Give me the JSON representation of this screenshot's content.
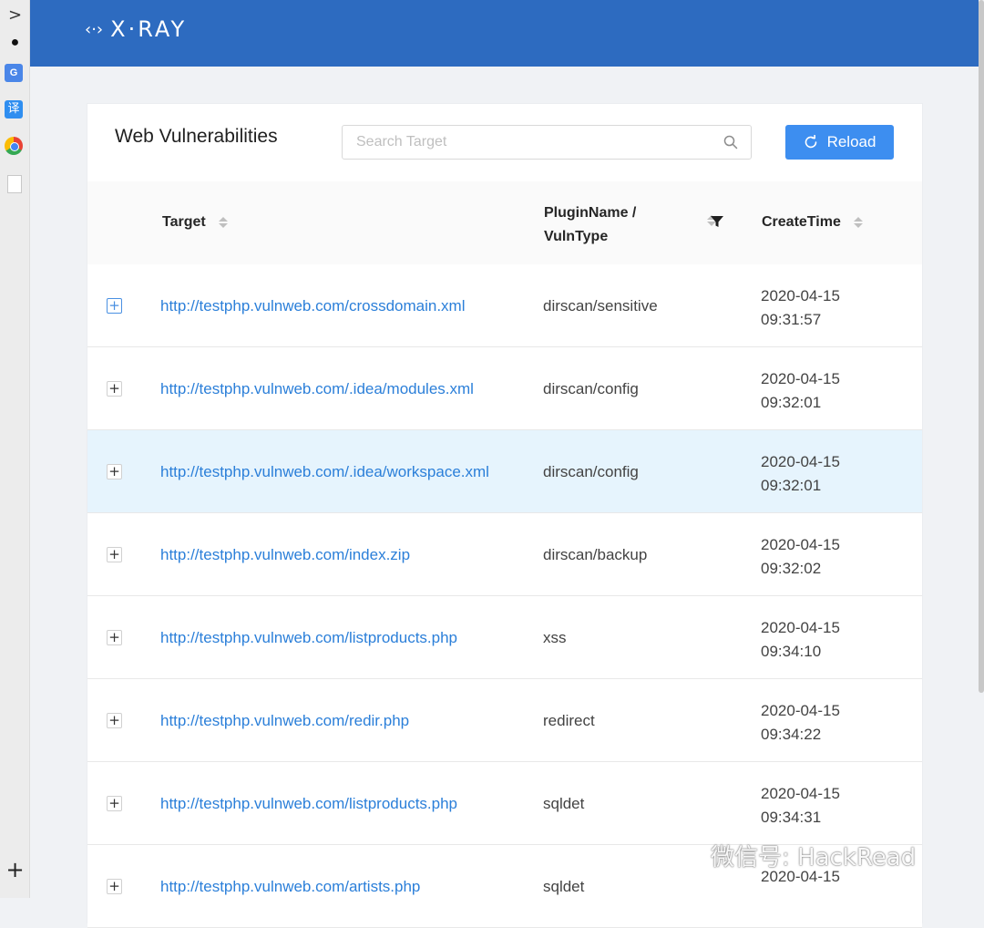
{
  "header": {
    "logo_text": "X·RAY",
    "logo_mark": "‹·›"
  },
  "card": {
    "title": "Web Vulnerabilities",
    "search_placeholder": "Search Target",
    "reload_label": "Reload"
  },
  "table": {
    "columns": {
      "target": "Target",
      "plugin_line1": "PluginName /",
      "plugin_line2": "VulnType",
      "time": "CreateTime"
    },
    "rows": [
      {
        "target": "http://testphp.vulnweb.com/crossdomain.xml",
        "plugin": "dirscan/sensitive",
        "date": "2020-04-15",
        "time": "09:31:57"
      },
      {
        "target": "http://testphp.vulnweb.com/.idea/modules.xml",
        "plugin": "dirscan/config",
        "date": "2020-04-15",
        "time": "09:32:01"
      },
      {
        "target": "http://testphp.vulnweb.com/.idea/workspace.xml",
        "plugin": "dirscan/config",
        "date": "2020-04-15",
        "time": "09:32:01"
      },
      {
        "target": "http://testphp.vulnweb.com/index.zip",
        "plugin": "dirscan/backup",
        "date": "2020-04-15",
        "time": "09:32:02"
      },
      {
        "target": "http://testphp.vulnweb.com/listproducts.php",
        "plugin": "xss",
        "date": "2020-04-15",
        "time": "09:34:10"
      },
      {
        "target": "http://testphp.vulnweb.com/redir.php",
        "plugin": "redirect",
        "date": "2020-04-15",
        "time": "09:34:22"
      },
      {
        "target": "http://testphp.vulnweb.com/listproducts.php",
        "plugin": "sqldet",
        "date": "2020-04-15",
        "time": "09:34:31"
      },
      {
        "target": "http://testphp.vulnweb.com/artists.php",
        "plugin": "sqldet",
        "date": "2020-04-15",
        "time": ""
      }
    ],
    "expand_symbol": "+"
  },
  "sidebar": {
    "chevron": ">",
    "dot": "●",
    "translate_g": "G",
    "translate_yi": "译",
    "plus": "+"
  },
  "colors": {
    "header_bg": "#2d6bc0",
    "link": "#2b7fd9",
    "button": "#3d8ef0",
    "highlight_row": "#e6f4fd"
  },
  "watermark": "微信号: HackRead"
}
